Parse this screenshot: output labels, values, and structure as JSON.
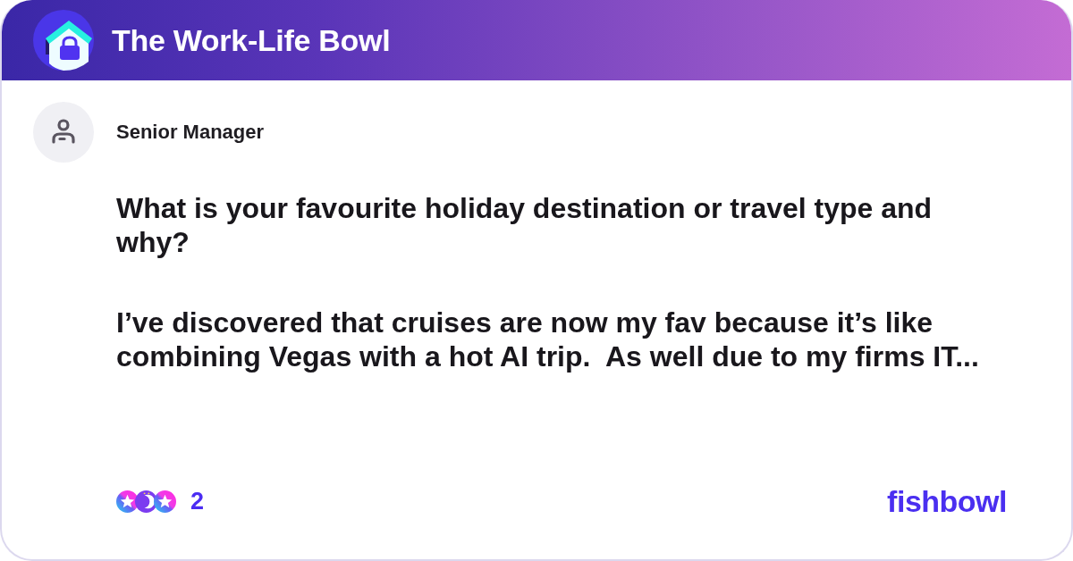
{
  "community": {
    "name": "The Work-Life Bowl"
  },
  "post": {
    "author": "Senior Manager",
    "title": "What is your favourite holiday destination or travel type and why?",
    "body": "I’ve discovered that cruises are now my fav because it’s like combining Vegas with a hot AI trip.  As well due to my firms IT..."
  },
  "reactions": {
    "count": "2"
  },
  "brand": {
    "logo_text": "fishbowl"
  }
}
